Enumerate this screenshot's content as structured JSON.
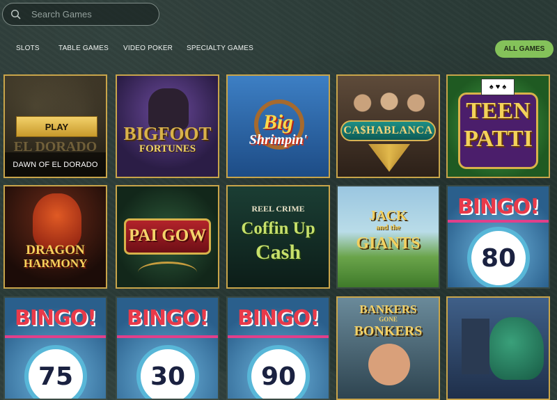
{
  "search": {
    "placeholder": "Search Games"
  },
  "nav": {
    "tabs": [
      "SLOTS",
      "TABLE GAMES",
      "VIDEO POKER",
      "SPECIALTY GAMES"
    ],
    "all_games": "ALL GAMES"
  },
  "tiles": [
    {
      "title": "EL DORADO",
      "play": "PLAY",
      "hover_name": "DAWN OF EL DORADO"
    },
    {
      "title": "BIGFOOT",
      "sub": "FORTUNES"
    },
    {
      "title": "Big",
      "sub": "Shrimpin'"
    },
    {
      "title": "CA$HABLANCA"
    },
    {
      "title": "TEEN",
      "sub": "PATTI"
    },
    {
      "title": "DRAGON",
      "sub": "HARMONY"
    },
    {
      "title": "PAI GOW"
    },
    {
      "title": "REEL CRIME",
      "sub": "Coffin Up",
      "sub2": "Cash"
    },
    {
      "title": "JACK",
      "sub": "and the",
      "sub2": "GIANTS"
    },
    {
      "title": "BINGO!",
      "number": "80"
    },
    {
      "title": "BINGO!",
      "number": "75"
    },
    {
      "title": "BINGO!",
      "number": "30"
    },
    {
      "title": "BINGO!",
      "number": "90"
    },
    {
      "title": "BANKERS",
      "sub": "GONE",
      "sub2": "BONKERS"
    },
    {
      "title": ""
    }
  ],
  "colors": {
    "accent": "#84c25a",
    "frame": "#c9a54a"
  }
}
